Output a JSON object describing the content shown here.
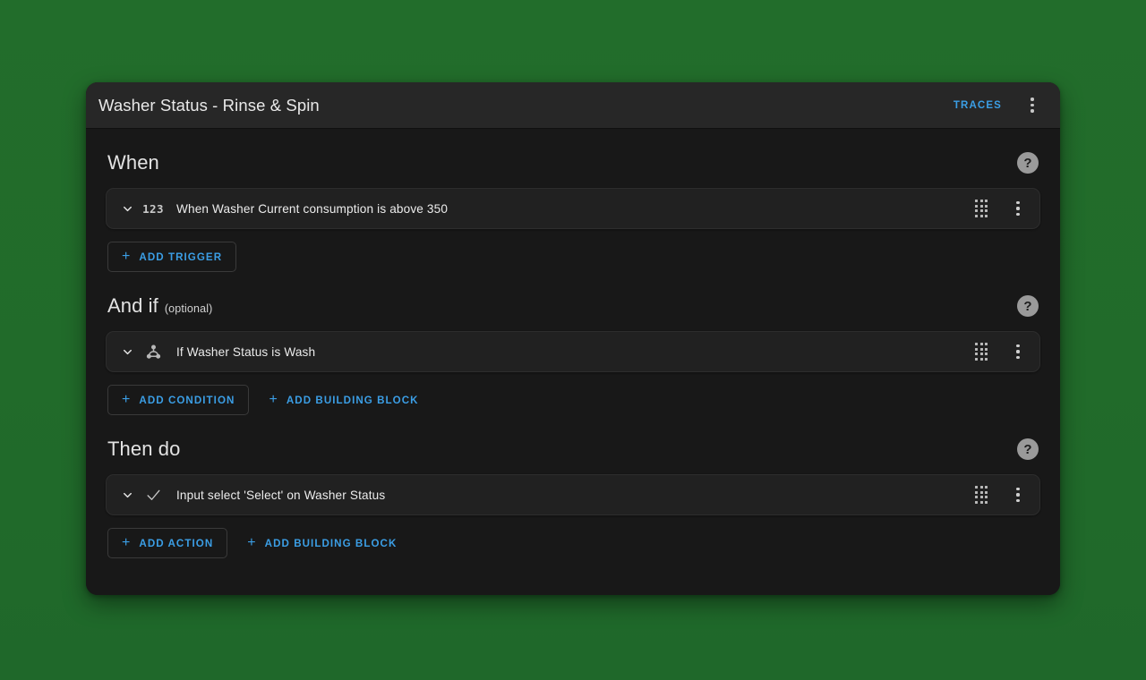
{
  "colors": {
    "background": "#216b2a",
    "card": "#181818",
    "header": "#272727",
    "row": "#212121",
    "accent": "#3b9ee5",
    "text": "#ececec"
  },
  "header": {
    "title": "Washer Status - Rinse & Spin",
    "traces_label": "TRACES",
    "menu_icon": "kebab-menu-icon"
  },
  "sections": [
    {
      "title": "When",
      "optional": "",
      "help_icon": "help-circle-icon",
      "row": {
        "icon": "numeric-123-icon",
        "label": "When Washer Current consumption is above 350",
        "chevron_icon": "chevron-down-icon",
        "drag_icon": "drag-handle-icon",
        "menu_icon": "kebab-menu-icon"
      },
      "buttons": [
        {
          "label": "ADD TRIGGER",
          "icon": "plus-icon",
          "outlined": true
        }
      ]
    },
    {
      "title": "And if",
      "optional": "(optional)",
      "help_icon": "help-circle-icon",
      "row": {
        "icon": "call-split-icon",
        "label": "If Washer Status is Wash",
        "chevron_icon": "chevron-down-icon",
        "drag_icon": "drag-handle-icon",
        "menu_icon": "kebab-menu-icon"
      },
      "buttons": [
        {
          "label": "ADD CONDITION",
          "icon": "plus-icon",
          "outlined": true
        },
        {
          "label": "ADD BUILDING BLOCK",
          "icon": "plus-icon",
          "outlined": false
        }
      ]
    },
    {
      "title": "Then do",
      "optional": "",
      "help_icon": "help-circle-icon",
      "row": {
        "icon": "check-icon",
        "label": "Input select 'Select' on Washer Status",
        "chevron_icon": "chevron-down-icon",
        "drag_icon": "drag-handle-icon",
        "menu_icon": "kebab-menu-icon"
      },
      "buttons": [
        {
          "label": "ADD ACTION",
          "icon": "plus-icon",
          "outlined": true
        },
        {
          "label": "ADD BUILDING BLOCK",
          "icon": "plus-icon",
          "outlined": false
        }
      ]
    }
  ],
  "icons": {
    "help_glyph": "?",
    "plus_glyph": "+",
    "numeric_glyph": "123"
  }
}
